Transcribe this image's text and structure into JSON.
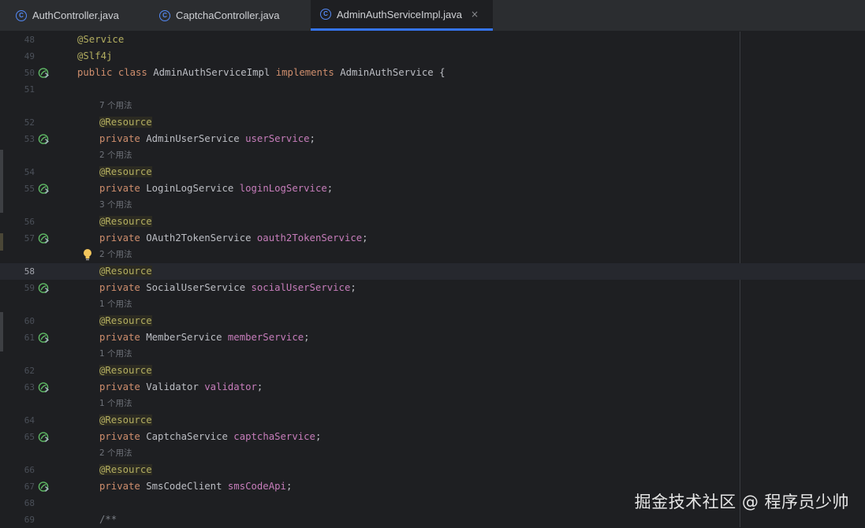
{
  "tabs": [
    {
      "label": "AuthController.java",
      "icon": "class-icon",
      "icon_letter": "C",
      "active": false
    },
    {
      "label": "CaptchaController.java",
      "icon": "class-icon",
      "icon_letter": "C",
      "active": false
    },
    {
      "label": "AdminAuthServiceImpl.java",
      "icon": "class-icon",
      "icon_letter": "C",
      "active": true,
      "close": "×"
    }
  ],
  "colors": {
    "accent": "#3574f0",
    "background": "#1e1f22",
    "keyword": "#cf8e6d",
    "annotation": "#b3ae60",
    "field": "#c77dbb"
  },
  "editor": {
    "current_line": "58",
    "lines": [
      {
        "ln": "48",
        "text": "@Service"
      },
      {
        "ln": "49",
        "text": "@Slf4j"
      },
      {
        "ln": "50",
        "kw": "public class",
        "cls": "AdminAuthServiceImpl",
        "kw2": "implements",
        "iface": "AdminAuthService",
        "brace": "{",
        "icon": "bean-icon"
      },
      {
        "ln": "51"
      },
      {
        "hint": "7 个用法"
      },
      {
        "ln": "52",
        "text": "@Resource"
      },
      {
        "ln": "53",
        "kw": "private",
        "type": "AdminUserService",
        "field": "userService",
        "end": ";",
        "icon": "bean-icon"
      },
      {
        "hint": "2 个用法"
      },
      {
        "ln": "54",
        "text": "@Resource"
      },
      {
        "ln": "55",
        "kw": "private",
        "type": "LoginLogService",
        "field": "loginLogService",
        "end": ";",
        "icon": "bean-icon"
      },
      {
        "hint": "3 个用法"
      },
      {
        "ln": "56",
        "text": "@Resource"
      },
      {
        "ln": "57",
        "kw": "private",
        "type": "OAuth2TokenService",
        "field": "oauth2TokenService",
        "end": ";",
        "icon": "bean-icon"
      },
      {
        "hint": "2 个用法",
        "icon": "bulb-icon"
      },
      {
        "ln": "58",
        "text": "@Resource"
      },
      {
        "ln": "59",
        "kw": "private",
        "type": "SocialUserService",
        "field": "socialUserService",
        "end": ";",
        "icon": "bean-icon"
      },
      {
        "hint": "1 个用法"
      },
      {
        "ln": "60",
        "text": "@Resource"
      },
      {
        "ln": "61",
        "kw": "private",
        "type": "MemberService",
        "field": "memberService",
        "end": ";",
        "icon": "bean-icon"
      },
      {
        "hint": "1 个用法"
      },
      {
        "ln": "62",
        "text": "@Resource"
      },
      {
        "ln": "63",
        "kw": "private",
        "type": "Validator",
        "field": "validator",
        "end": ";",
        "icon": "bean-icon"
      },
      {
        "hint": "1 个用法"
      },
      {
        "ln": "64",
        "text": "@Resource"
      },
      {
        "ln": "65",
        "kw": "private",
        "type": "CaptchaService",
        "field": "captchaService",
        "end": ";",
        "icon": "bean-icon"
      },
      {
        "hint": "2 个用法"
      },
      {
        "ln": "66",
        "text": "@Resource"
      },
      {
        "ln": "67",
        "kw": "private",
        "type": "SmsCodeClient",
        "field": "smsCodeApi",
        "end": ";",
        "icon": "bean-icon"
      },
      {
        "ln": "68"
      },
      {
        "ln": "69",
        "comment": "/**"
      }
    ]
  },
  "watermark": "掘金技术社区 @ 程序员少帅"
}
